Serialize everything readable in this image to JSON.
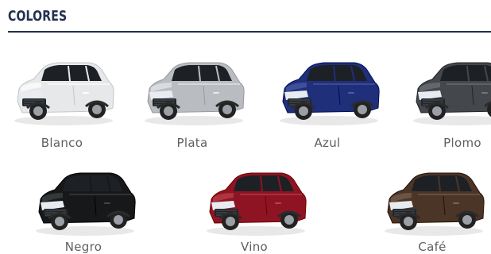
{
  "section": {
    "title": "COLORES"
  },
  "colors": [
    {
      "name": "Blanco",
      "hex": "#e7e8ea"
    },
    {
      "name": "Plata",
      "hex": "#b9bcc0"
    },
    {
      "name": "Azul",
      "hex": "#1f2f7a"
    },
    {
      "name": "Plomo",
      "hex": "#44474b"
    },
    {
      "name": "Negro",
      "hex": "#17181a"
    },
    {
      "name": "Vino",
      "hex": "#8f1423"
    },
    {
      "name": "Café",
      "hex": "#4b3526"
    }
  ]
}
